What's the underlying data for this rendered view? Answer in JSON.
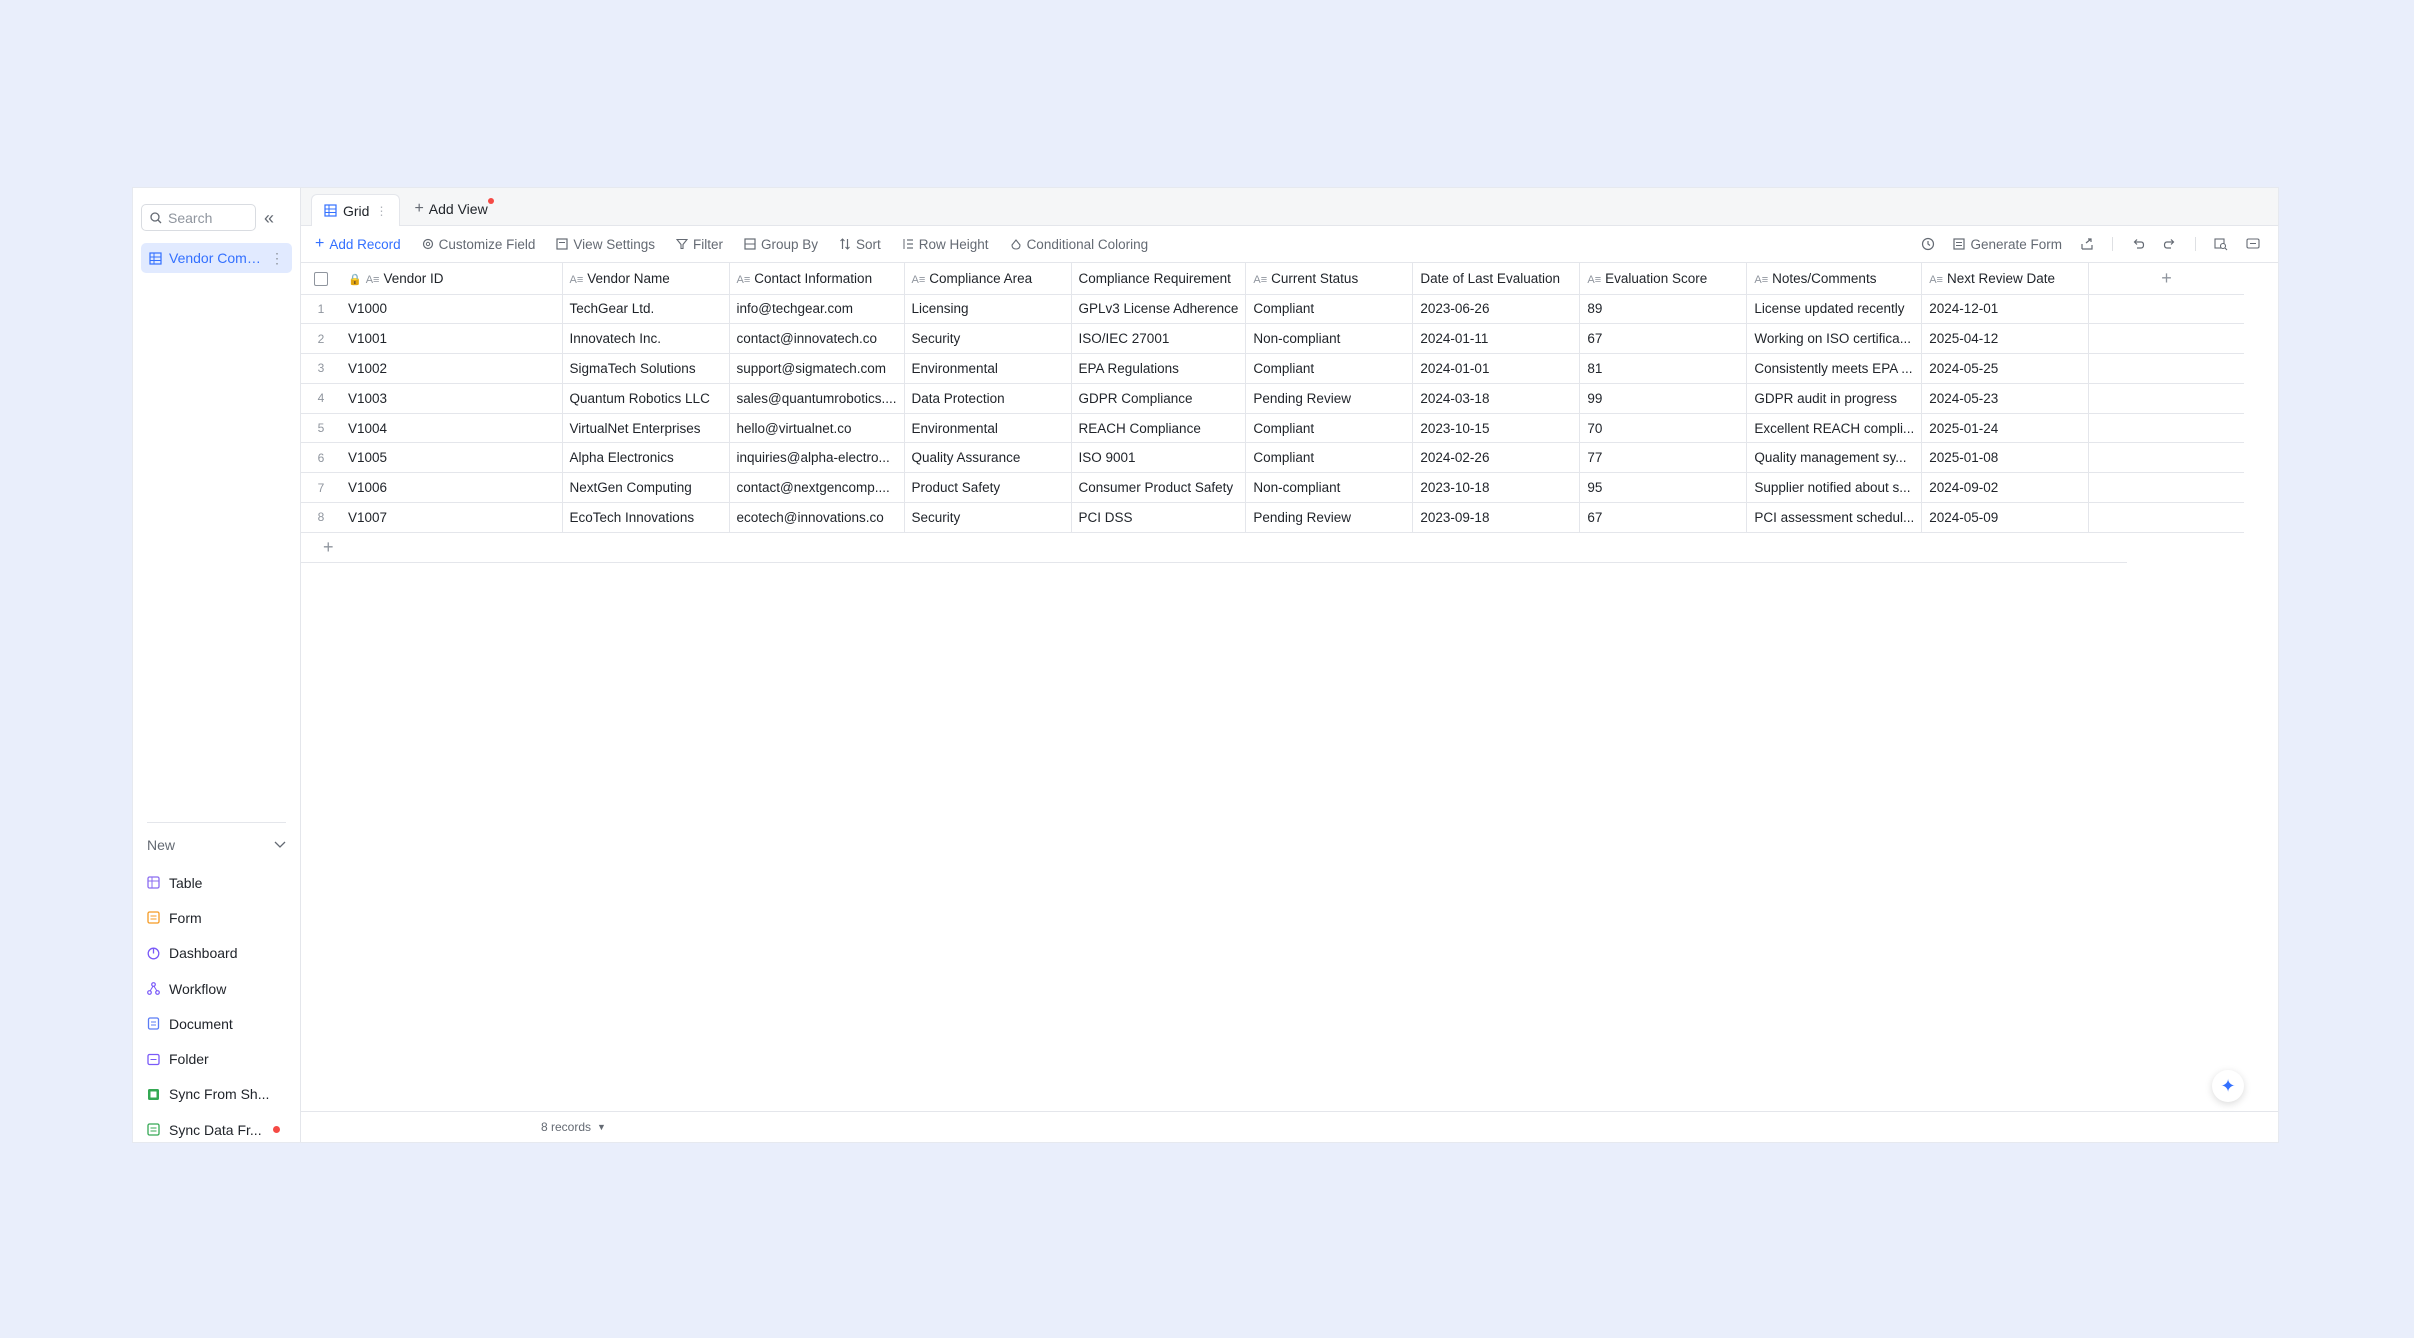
{
  "colors": {
    "accent": "#3370ff",
    "background": "#e9eefb",
    "red_dot": "#f54a45"
  },
  "sidebar": {
    "search_placeholder": "Search",
    "collapse_icon": "double-chevron-left-icon",
    "table_item": {
      "label": "Vendor Compl...",
      "icon": "grid-icon"
    },
    "new_label": "New",
    "new_items": [
      {
        "label": "Table",
        "icon": "table-icon",
        "color": "#8b6cf0"
      },
      {
        "label": "Form",
        "icon": "form-icon",
        "color": "#f59a23"
      },
      {
        "label": "Dashboard",
        "icon": "dashboard-icon",
        "color": "#7a5af8"
      },
      {
        "label": "Workflow",
        "icon": "workflow-icon",
        "color": "#7a5af8"
      },
      {
        "label": "Document",
        "icon": "document-icon",
        "color": "#5b7cf5"
      },
      {
        "label": "Folder",
        "icon": "folder-icon",
        "color": "#7a5af8"
      },
      {
        "label": "Sync From Sh...",
        "icon": "sync-sheet-icon",
        "color": "#34a853"
      },
      {
        "label": "Sync Data Fr...",
        "icon": "sync-data-icon",
        "color": "#34a853"
      }
    ]
  },
  "tabs": {
    "grid_label": "Grid",
    "add_view_label": "Add View"
  },
  "toolbar": {
    "add_record": "Add Record",
    "customize_field": "Customize Field",
    "view_settings": "View Settings",
    "filter": "Filter",
    "group_by": "Group By",
    "sort": "Sort",
    "row_height": "Row Height",
    "conditional_coloring": "Conditional Coloring",
    "generate_form": "Generate Form"
  },
  "table": {
    "columns": [
      "Vendor ID",
      "Vendor Name",
      "Contact Information",
      "Compliance Area",
      "Compliance Requirement",
      "Current Status",
      "Date of Last Evaluation",
      "Evaluation Score",
      "Notes/Comments",
      "Next Review Date"
    ],
    "rows": [
      {
        "num": "1",
        "cells": [
          "V1000",
          "TechGear Ltd.",
          "info@techgear.com",
          "Licensing",
          "GPLv3 License Adherence",
          "Compliant",
          "2023-06-26",
          "89",
          "License updated recently",
          "2024-12-01"
        ]
      },
      {
        "num": "2",
        "cells": [
          "V1001",
          "Innovatech Inc.",
          "contact@innovatech.co",
          "Security",
          "ISO/IEC 27001",
          "Non-compliant",
          "2024-01-11",
          "67",
          "Working on ISO certifica...",
          "2025-04-12"
        ]
      },
      {
        "num": "3",
        "cells": [
          "V1002",
          "SigmaTech Solutions",
          "support@sigmatech.com",
          "Environmental",
          "EPA Regulations",
          "Compliant",
          "2024-01-01",
          "81",
          "Consistently meets EPA ...",
          "2024-05-25"
        ]
      },
      {
        "num": "4",
        "cells": [
          "V1003",
          "Quantum Robotics LLC",
          "sales@quantumrobotics....",
          "Data Protection",
          "GDPR Compliance",
          "Pending Review",
          "2024-03-18",
          "99",
          "GDPR audit in progress",
          "2024-05-23"
        ]
      },
      {
        "num": "5",
        "cells": [
          "V1004",
          "VirtualNet Enterprises",
          "hello@virtualnet.co",
          "Environmental",
          "REACH Compliance",
          "Compliant",
          "2023-10-15",
          "70",
          "Excellent REACH compli...",
          "2025-01-24"
        ]
      },
      {
        "num": "6",
        "cells": [
          "V1005",
          "Alpha Electronics",
          "inquiries@alpha-electro...",
          "Quality Assurance",
          "ISO 9001",
          "Compliant",
          "2024-02-26",
          "77",
          "Quality management sy...",
          "2025-01-08"
        ]
      },
      {
        "num": "7",
        "cells": [
          "V1006",
          "NextGen Computing",
          "contact@nextgencomp....",
          "Product Safety",
          "Consumer Product Safety",
          "Non-compliant",
          "2023-10-18",
          "95",
          "Supplier notified about s...",
          "2024-09-02"
        ]
      },
      {
        "num": "8",
        "cells": [
          "V1007",
          "EcoTech Innovations",
          "ecotech@innovations.co",
          "Security",
          "PCI DSS",
          "Pending Review",
          "2023-09-18",
          "67",
          "PCI assessment schedul...",
          "2024-05-09"
        ]
      }
    ]
  },
  "footer": {
    "records_label": "8 records"
  }
}
